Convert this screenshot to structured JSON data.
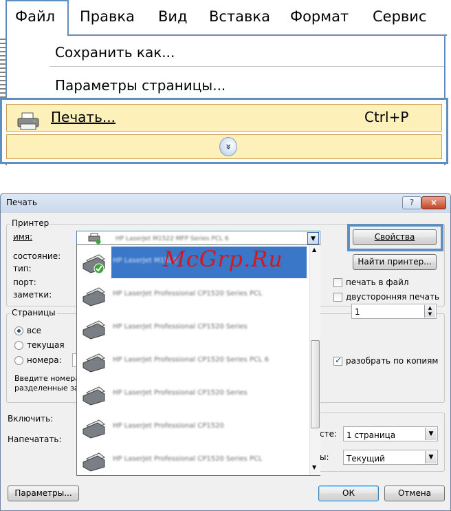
{
  "menu": {
    "bar_items": [
      "Файл",
      "Правка",
      "Вид",
      "Вставка",
      "Формат",
      "Сервис"
    ],
    "dropdown": {
      "save_as": "Сохранить как...",
      "page_setup": "Параметры страницы...",
      "print": "Печать...",
      "print_shortcut": "Ctrl+P",
      "expand_glyph": "»"
    }
  },
  "dialog": {
    "title": "Печать",
    "help_glyph": "?",
    "close_glyph": "×",
    "printer": {
      "group_label": "Принтер",
      "name_label": "имя:",
      "status_label": "состояние:",
      "type_label": "тип:",
      "port_label": "порт:",
      "notes_label": "заметки:",
      "properties_button": "Свойства",
      "find_printer_button": "Найти принтер...",
      "print_to_file": "печать в файл",
      "duplex": "двусторонняя печать",
      "selected_name_blurred": "HP LaserJet M1522 MFP Series PCL 6"
    },
    "printer_list": [
      "HP LaserJet M1522",
      "HP LaserJet Professional CP1520 Series PCL",
      "HP LaserJet Professional CP1520 Series",
      "HP LaserJet Professional CP1520 Series PCL 6",
      "HP LaserJet Professional CP1520 Series",
      "HP LaserJet Professional CP1520",
      "HP LaserJet Professional CP1520 Series PCL"
    ],
    "pages": {
      "group_label": "Страницы",
      "all": "все",
      "current": "текущая",
      "numbers": "номера:",
      "hint": "Введите номера\nразделенные за",
      "copies_value": "1",
      "collate": "разобрать по копиям"
    },
    "include_label": "Включить:",
    "print_what_label": "Напечатать:",
    "per_sheet_label_tail": "сте:",
    "per_sheet_value": "1 страница",
    "scale_label_tail": "ы:",
    "scale_value": "Текущий",
    "options_button": "Параметры...",
    "ok_button": "ОК",
    "cancel_button": "Отмена"
  },
  "watermark": "McGrp.Ru",
  "colors": {
    "highlight_fill": "#fdf0b9",
    "annotation_border": "#5f8fbf",
    "watermark": "#d41820"
  }
}
